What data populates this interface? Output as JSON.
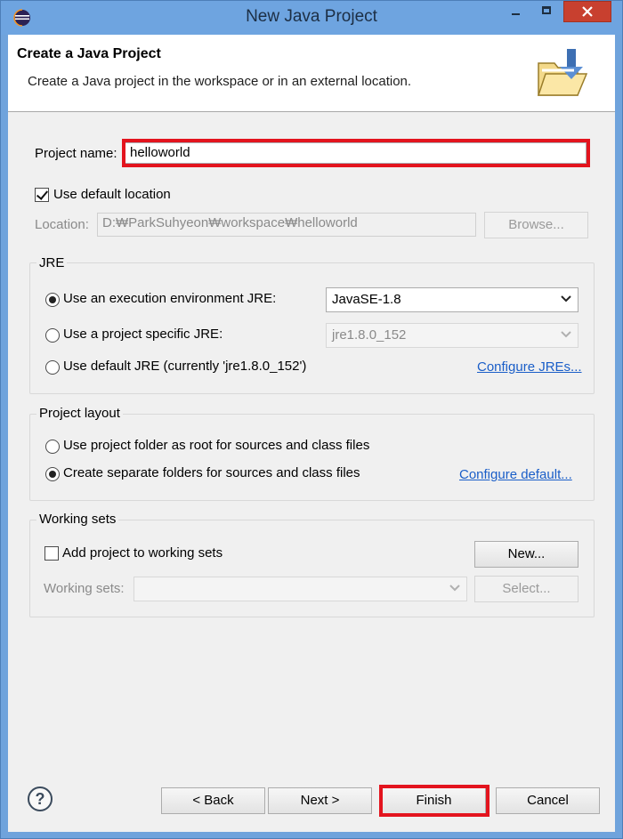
{
  "window": {
    "title": "New Java Project",
    "icons": {
      "app": "eclipse-icon",
      "minimize": "minimize-icon",
      "maximize": "maximize-icon",
      "close": "close-icon"
    },
    "colors": {
      "titlebar": "#6ea4e0",
      "close": "#c8402f",
      "highlight": "#e3141e",
      "link": "#1a5ec8"
    }
  },
  "header": {
    "title": "Create a Java Project",
    "description": "Create a Java project in the workspace or in an external location.",
    "icon": "new-project-folder-icon"
  },
  "form": {
    "project_name_label": "Project name:",
    "project_name_value": "helloworld",
    "use_default_location_label": "Use default location",
    "use_default_location_checked": true,
    "location_label": "Location:",
    "location_value": "D:₩ParkSuhyeon₩workspace₩helloworld",
    "browse_label": "Browse..."
  },
  "jre": {
    "group_label": "JRE",
    "option_execution_env": "Use an execution environment JRE:",
    "option_project_specific": "Use a project specific JRE:",
    "option_default": "Use default JRE (currently 'jre1.8.0_152')",
    "execution_env_value": "JavaSE-1.8",
    "project_specific_value": "jre1.8.0_152",
    "configure_link": "Configure JREs..."
  },
  "layout": {
    "group_label": "Project layout",
    "option_root": "Use project folder as root for sources and class files",
    "option_separate": "Create separate folders for sources and class files",
    "configure_link": "Configure default..."
  },
  "working_sets": {
    "group_label": "Working sets",
    "add_label": "Add project to working sets",
    "new_button": "New...",
    "sets_label": "Working sets:",
    "select_button": "Select..."
  },
  "footer": {
    "help_icon": "help-icon",
    "back_label": "< Back",
    "next_label": "Next >",
    "finish_label": "Finish",
    "cancel_label": "Cancel"
  }
}
